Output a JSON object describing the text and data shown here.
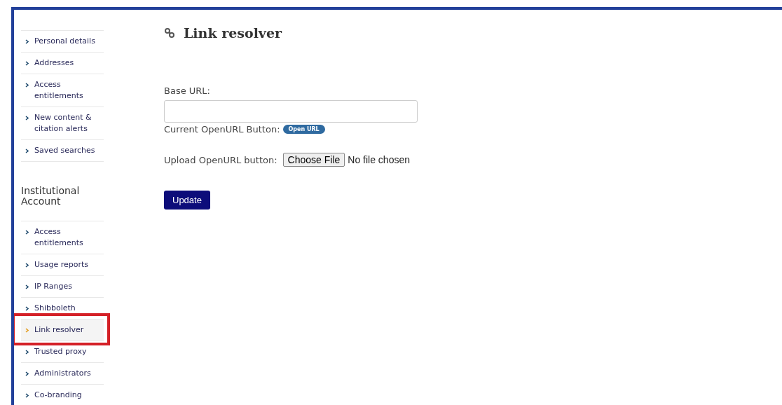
{
  "sidebar": {
    "sections": [
      {
        "items": [
          {
            "label": "Personal details",
            "selected": false
          },
          {
            "label": "Addresses",
            "selected": false
          },
          {
            "label": "Access entitlements",
            "selected": false
          },
          {
            "label": "New content & citation alerts",
            "selected": false
          },
          {
            "label": "Saved searches",
            "selected": false
          }
        ]
      },
      {
        "heading": "Institutional Account",
        "items": [
          {
            "label": "Access entitlements",
            "selected": false
          },
          {
            "label": "Usage reports",
            "selected": false
          },
          {
            "label": "IP Ranges",
            "selected": false
          },
          {
            "label": "Shibboleth",
            "selected": false
          },
          {
            "label": "Link resolver",
            "selected": true,
            "highlighted": true
          },
          {
            "label": "Trusted proxy",
            "selected": false
          },
          {
            "label": "Administrators",
            "selected": false
          },
          {
            "label": "Co-branding",
            "selected": false
          }
        ]
      }
    ]
  },
  "page": {
    "title": "Link resolver",
    "base_url": {
      "label": "Base URL:"
    },
    "current_button": {
      "label": "Current OpenURL Button:",
      "badge": "Open URL"
    },
    "upload": {
      "label": "Upload OpenURL button:",
      "button": "Choose File",
      "status": "No file chosen"
    },
    "submit": "Update"
  }
}
